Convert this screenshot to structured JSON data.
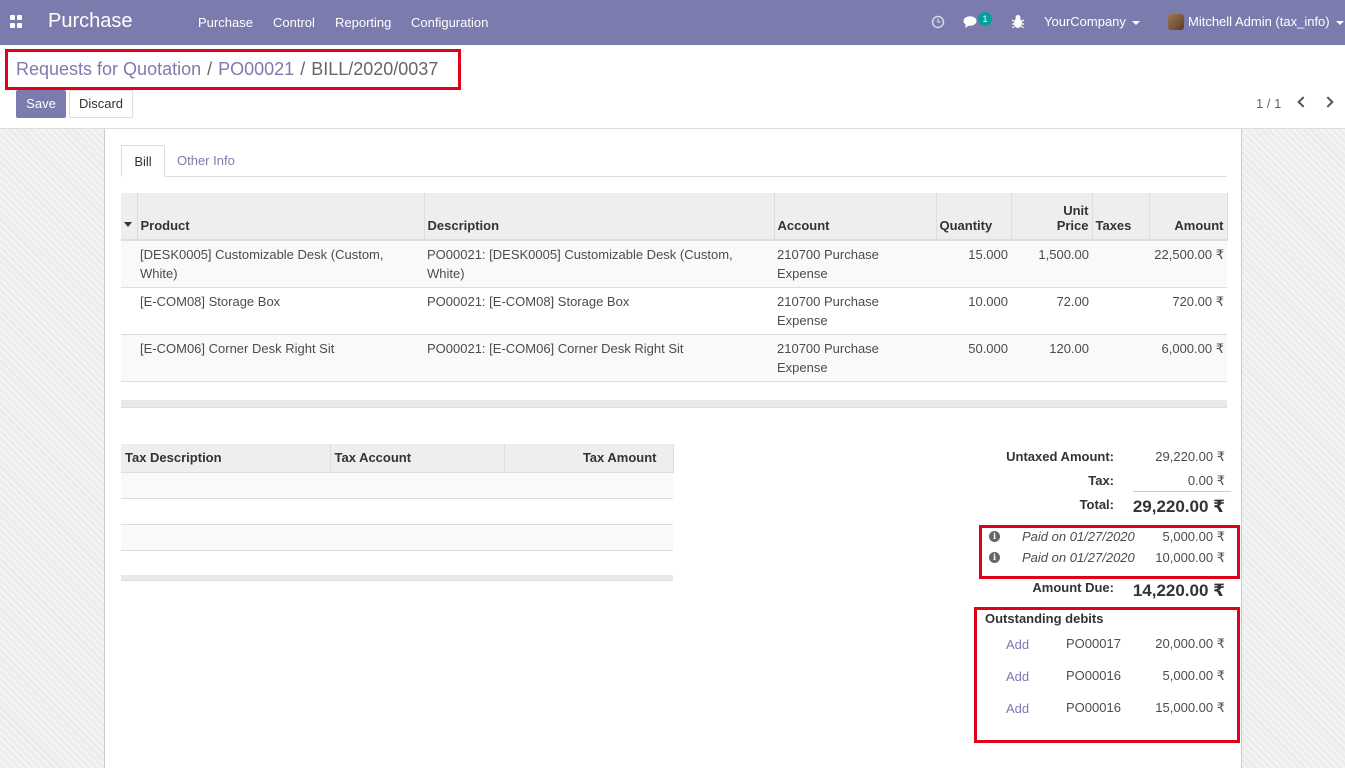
{
  "navbar": {
    "app_title": "Purchase",
    "menu": [
      "Purchase",
      "Control",
      "Reporting",
      "Configuration"
    ],
    "chat_badge": "1",
    "company": "YourCompany",
    "user": "Mitchell Admin (tax_info)"
  },
  "breadcrumb": {
    "root": "Requests for Quotation",
    "parent": "PO00021",
    "current": "BILL/2020/0037",
    "separator": "/"
  },
  "buttons": {
    "save": "Save",
    "discard": "Discard"
  },
  "pager": {
    "text": "1 / 1"
  },
  "tabs": {
    "bill": "Bill",
    "other_info": "Other Info"
  },
  "lines_table": {
    "headers": {
      "product": "Product",
      "description": "Description",
      "account": "Account",
      "quantity": "Quantity",
      "unit_price": "Unit Price",
      "taxes": "Taxes",
      "amount": "Amount"
    },
    "rows": [
      {
        "product": "[DESK0005] Customizable Desk (Custom, White)",
        "description": "PO00021: [DESK0005] Customizable Desk (Custom, White)",
        "account": "210700 Purchase Expense",
        "quantity": "15.000",
        "unit_price": "1,500.00",
        "taxes": "",
        "amount": "22,500.00 ₹"
      },
      {
        "product": "[E-COM08] Storage Box",
        "description": "PO00021: [E-COM08] Storage Box",
        "account": "210700 Purchase Expense",
        "quantity": "10.000",
        "unit_price": "72.00",
        "taxes": "",
        "amount": "720.00 ₹"
      },
      {
        "product": "[E-COM06] Corner Desk Right Sit",
        "description": "PO00021: [E-COM06] Corner Desk Right Sit",
        "account": "210700 Purchase Expense",
        "quantity": "50.000",
        "unit_price": "120.00",
        "taxes": "",
        "amount": "6,000.00 ₹"
      }
    ]
  },
  "tax_table": {
    "headers": {
      "description": "Tax Description",
      "account": "Tax Account",
      "amount": "Tax Amount"
    }
  },
  "totals": {
    "untaxed_label": "Untaxed Amount:",
    "untaxed": "29,220.00 ₹",
    "tax_label": "Tax:",
    "tax": "0.00 ₹",
    "total_label": "Total:",
    "total": "29,220.00 ₹",
    "payments": [
      {
        "label": "Paid on 01/27/2020",
        "amount": "5,000.00 ₹"
      },
      {
        "label": "Paid on 01/27/2020",
        "amount": "10,000.00 ₹"
      }
    ],
    "amount_due_label": "Amount Due:",
    "amount_due": "14,220.00 ₹"
  },
  "outstanding": {
    "title": "Outstanding debits",
    "items": [
      {
        "action": "Add",
        "ref": "PO00017",
        "amount": "20,000.00 ₹"
      },
      {
        "action": "Add",
        "ref": "PO00016",
        "amount": "5,000.00 ₹"
      },
      {
        "action": "Add",
        "ref": "PO00016",
        "amount": "15,000.00 ₹"
      }
    ]
  },
  "colors": {
    "brand": "#7c7bad",
    "highlight": "#e0001a",
    "badge": "#00a09d"
  }
}
